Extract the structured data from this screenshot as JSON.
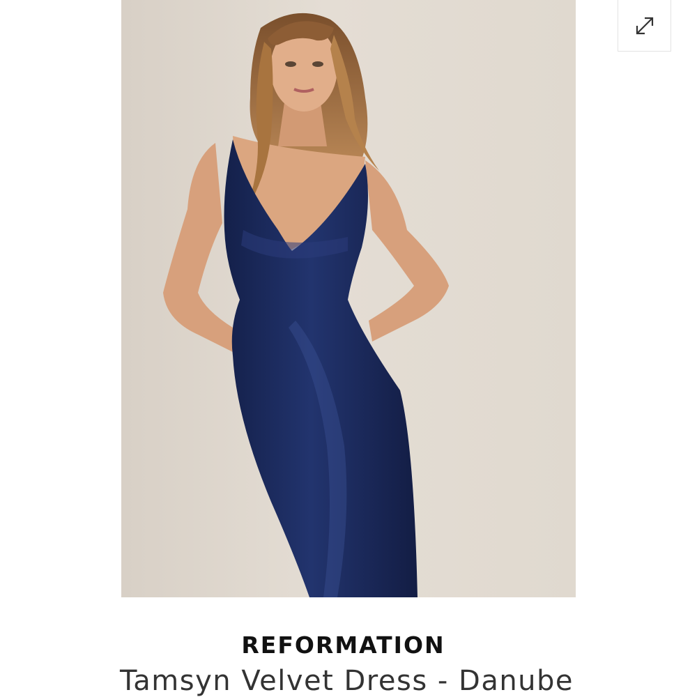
{
  "product": {
    "brand": "REFORMATION",
    "title": "Tamsyn Velvet Dress - Danube"
  },
  "image": {
    "subject": "model-wearing-navy-velvet-dress",
    "background_color": "#ddd6cc",
    "dress_color": "#1b2a5e",
    "skin_color": "#d7a07c",
    "hair_color": "#9b6a3e"
  },
  "icons": {
    "expand": "expand-diagonal-arrows-icon"
  }
}
